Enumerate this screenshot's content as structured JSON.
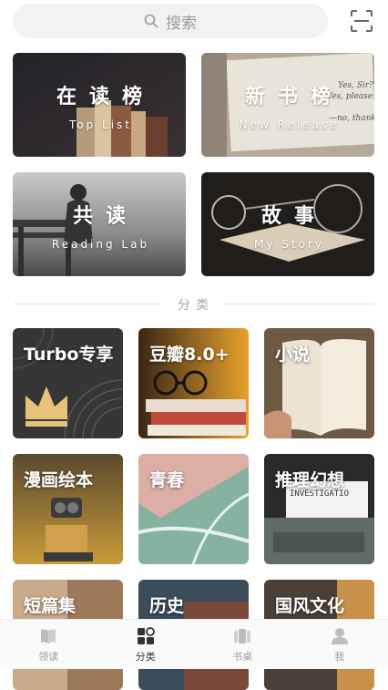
{
  "search": {
    "placeholder": "搜索"
  },
  "featured": [
    {
      "title": "在读榜",
      "subtitle": "Top List"
    },
    {
      "title": "新书榜",
      "subtitle": "New Release"
    },
    {
      "title": "共读",
      "subtitle": "Reading Lab"
    },
    {
      "title": "故事",
      "subtitle": "My Story"
    }
  ],
  "featured_art_text": {
    "quote_line_1": "Yes, Sir?",
    "quote_line_2": "Yes, please!",
    "quote_line_3": "—no, thanks."
  },
  "section_divider": "分类",
  "categories": [
    {
      "title": "Turbo专享"
    },
    {
      "title": "豆瓣8.0+"
    },
    {
      "title": "小说"
    },
    {
      "title": "漫画绘本"
    },
    {
      "title": "青春"
    },
    {
      "title": "推理幻想",
      "art_text": "INVESTIGATIO"
    },
    {
      "title": "短篇集"
    },
    {
      "title": "历史"
    },
    {
      "title": "国风文化"
    }
  ],
  "tabs": [
    {
      "label": "领读",
      "icon": "book-icon",
      "active": false
    },
    {
      "label": "分类",
      "icon": "grid-icon",
      "active": true
    },
    {
      "label": "书桌",
      "icon": "bookshelf-icon",
      "active": false
    },
    {
      "label": "我",
      "icon": "user-icon",
      "active": false
    }
  ],
  "colors": {
    "tab_active": "#333333",
    "tab_inactive": "#bdbdbd",
    "search_bg": "#f2f2f2",
    "crown": "#e8c27a"
  }
}
